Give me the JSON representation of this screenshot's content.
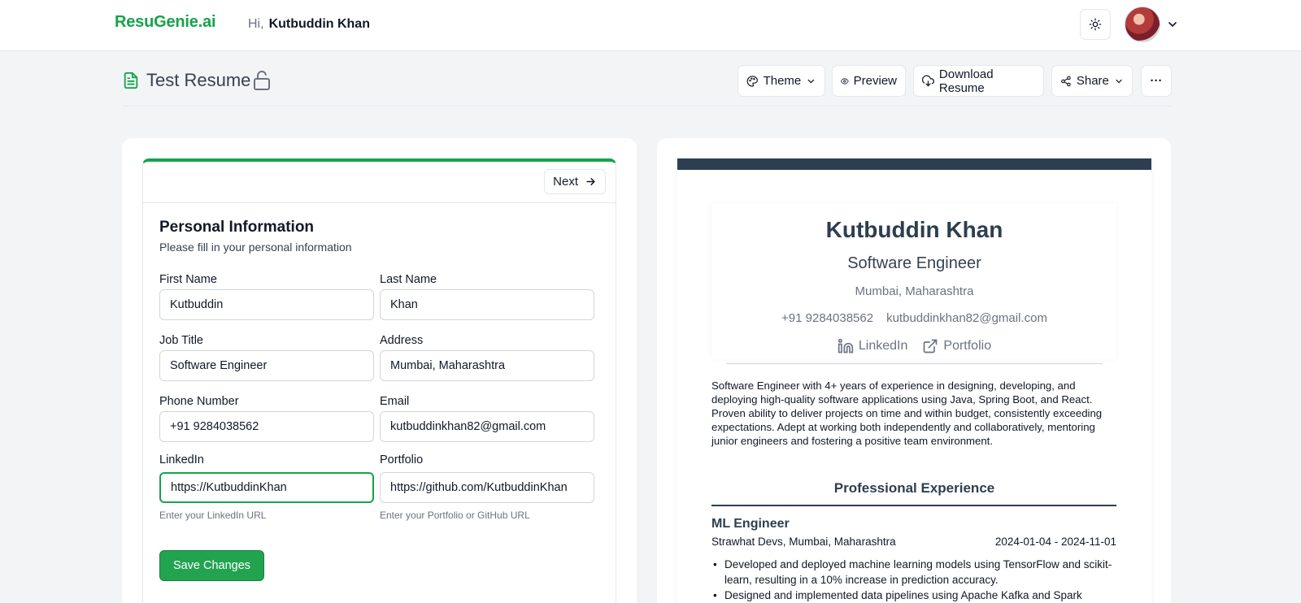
{
  "header": {
    "brand": "ResuGenie.ai",
    "greeting": "Hi,",
    "user_name": "Kutbuddin Khan",
    "theme_toggle_icon": "sun-icon",
    "avatar_caret_icon": "chevron-down-icon"
  },
  "toolbar": {
    "doc_title": "Test Resume",
    "theme_label": "Theme",
    "preview_label": "Preview",
    "download_label": "Download Resume",
    "share_label": "Share",
    "more_label": "···"
  },
  "form": {
    "next_label": "Next",
    "title": "Personal Information",
    "subtitle": "Please fill in your personal information",
    "fields": {
      "first_name": {
        "label": "First Name",
        "value": "Kutbuddin"
      },
      "last_name": {
        "label": "Last Name",
        "value": "Khan"
      },
      "job_title": {
        "label": "Job Title",
        "value": "Software Engineer"
      },
      "address": {
        "label": "Address",
        "value": "Mumbai, Maharashtra"
      },
      "phone": {
        "label": "Phone Number",
        "value": "+91 9284038562"
      },
      "email": {
        "label": "Email",
        "value": "kutbuddinkhan82@gmail.com"
      },
      "linkedin": {
        "label": "LinkedIn",
        "value": "https://KutbuddinKhan",
        "help": "Enter your LinkedIn URL"
      },
      "portfolio": {
        "label": "Portfolio",
        "value": "https://github.com/KutbuddinKhan",
        "help": "Enter your Portfolio or GitHub URL"
      }
    },
    "save_label": "Save Changes"
  },
  "resume": {
    "name": "Kutbuddin Khan",
    "title": "Software Engineer",
    "location": "Mumbai, Maharashtra",
    "phone": "+91 9284038562",
    "email": "kutbuddinkhan82@gmail.com",
    "linkedin_label": "LinkedIn",
    "portfolio_label": "Portfolio",
    "summary": "Software Engineer with 4+ years of experience in designing, developing, and deploying high-quality software applications using Java, Spring Boot, and React. Proven ability to deliver projects on time and within budget, consistently exceeding expectations. Adept at working both independently and collaboratively, mentoring junior engineers and fostering a positive team environment.",
    "experience_heading": "Professional Experience",
    "job": {
      "title": "ML Engineer",
      "company": "Strawhat Devs, Mumbai, Maharashtra",
      "dates": "2024-01-04 - 2024-11-01",
      "bullets": [
        "Developed and deployed machine learning models using TensorFlow and scikit-learn, resulting in a 10% increase in prediction accuracy.",
        "Designed and implemented data pipelines using Apache Kafka and Spark"
      ]
    }
  },
  "colors": {
    "brand_green": "#16a34a",
    "save_green": "#22a350",
    "resume_navy": "#2d3e50"
  }
}
